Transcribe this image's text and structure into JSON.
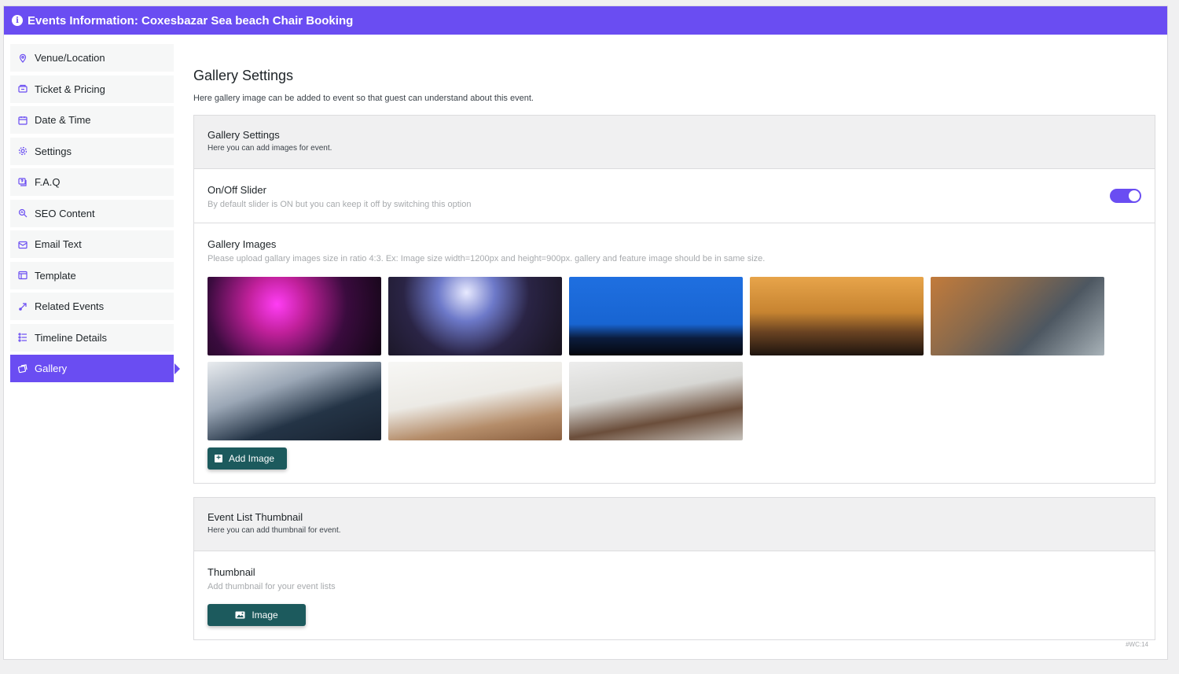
{
  "header": {
    "title": "Events Information: Coxesbazar Sea beach Chair Booking",
    "icon": "info-icon"
  },
  "sidebar": {
    "items": [
      {
        "label": "Venue/Location",
        "icon": "location-pin-icon"
      },
      {
        "label": "Ticket & Pricing",
        "icon": "ticket-icon"
      },
      {
        "label": "Date & Time",
        "icon": "calendar-icon"
      },
      {
        "label": "Settings",
        "icon": "gear-icon"
      },
      {
        "label": "F.A.Q",
        "icon": "faq-icon"
      },
      {
        "label": "SEO Content",
        "icon": "seo-search-icon"
      },
      {
        "label": "Email Text",
        "icon": "email-icon"
      },
      {
        "label": "Template",
        "icon": "template-icon"
      },
      {
        "label": "Related Events",
        "icon": "related-events-icon"
      },
      {
        "label": "Timeline Details",
        "icon": "timeline-icon"
      },
      {
        "label": "Gallery",
        "icon": "gallery-icon",
        "active": true
      }
    ]
  },
  "main": {
    "title": "Gallery Settings",
    "description": "Here gallery image can be added to event so that guest can understand about this event.",
    "gallery_box": {
      "title": "Gallery Settings",
      "description": "Here you can add images for event.",
      "slider": {
        "title": "On/Off Slider",
        "description": "By default slider is ON but you can keep it off by switching this option",
        "enabled": true
      },
      "images": {
        "title": "Gallery Images",
        "description": "Please upload gallary images size in ratio 4:3. Ex: Image size width=1200px and height=900px. gallery and feature image should be in same size.",
        "count": 8,
        "add_label": "Add Image"
      }
    },
    "thumbnail_box": {
      "title": "Event List Thumbnail",
      "description": "Here you can add thumbnail for event.",
      "thumbnail": {
        "title": "Thumbnail",
        "description": "Add thumbnail for your event lists",
        "button_label": "Image"
      }
    }
  },
  "footer": {
    "version": "#WC:14"
  },
  "colors": {
    "accent": "#6a4df2",
    "button": "#1c5a5d"
  }
}
